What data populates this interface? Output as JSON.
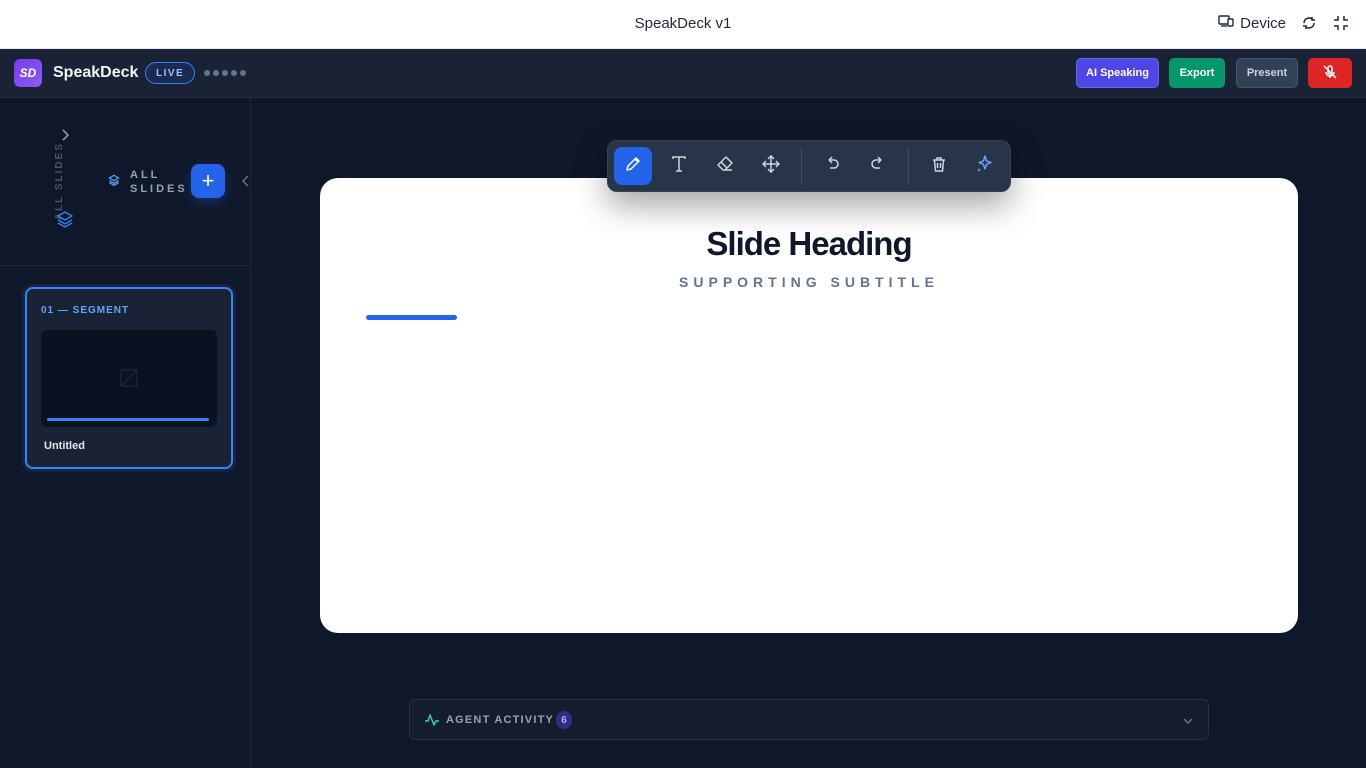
{
  "window": {
    "title": "SpeakDeck v1",
    "device_label": "Device"
  },
  "header": {
    "logo_text": "SD",
    "brand": "SpeakDeck",
    "live_label": "LIVE",
    "buttons": {
      "ai_speaking": "AI Speaking",
      "export": "Export",
      "present": "Present"
    }
  },
  "sidebar": {
    "vertical_label": "ALL SLIDES",
    "all_slides_label": "ALL SLIDES",
    "add_label": "+",
    "slides": [
      {
        "tag": "01 — SEGMENT",
        "title": "Untitled"
      }
    ]
  },
  "slide": {
    "heading": "Slide Heading",
    "subtitle": "SUPPORTING SUBTITLE"
  },
  "toolbar": {
    "tools": [
      "pencil-icon",
      "text-icon",
      "eraser-icon",
      "move-icon",
      "undo-icon",
      "redo-icon",
      "trash-icon",
      "sparkles-icon"
    ],
    "active_tool": "pencil"
  },
  "agent_activity": {
    "label": "AGENT ACTIVITY",
    "count": "6"
  },
  "colors": {
    "accent": "#2563eb",
    "export": "#059669",
    "ai": "#4f46e5",
    "mic": "#dc2626"
  }
}
